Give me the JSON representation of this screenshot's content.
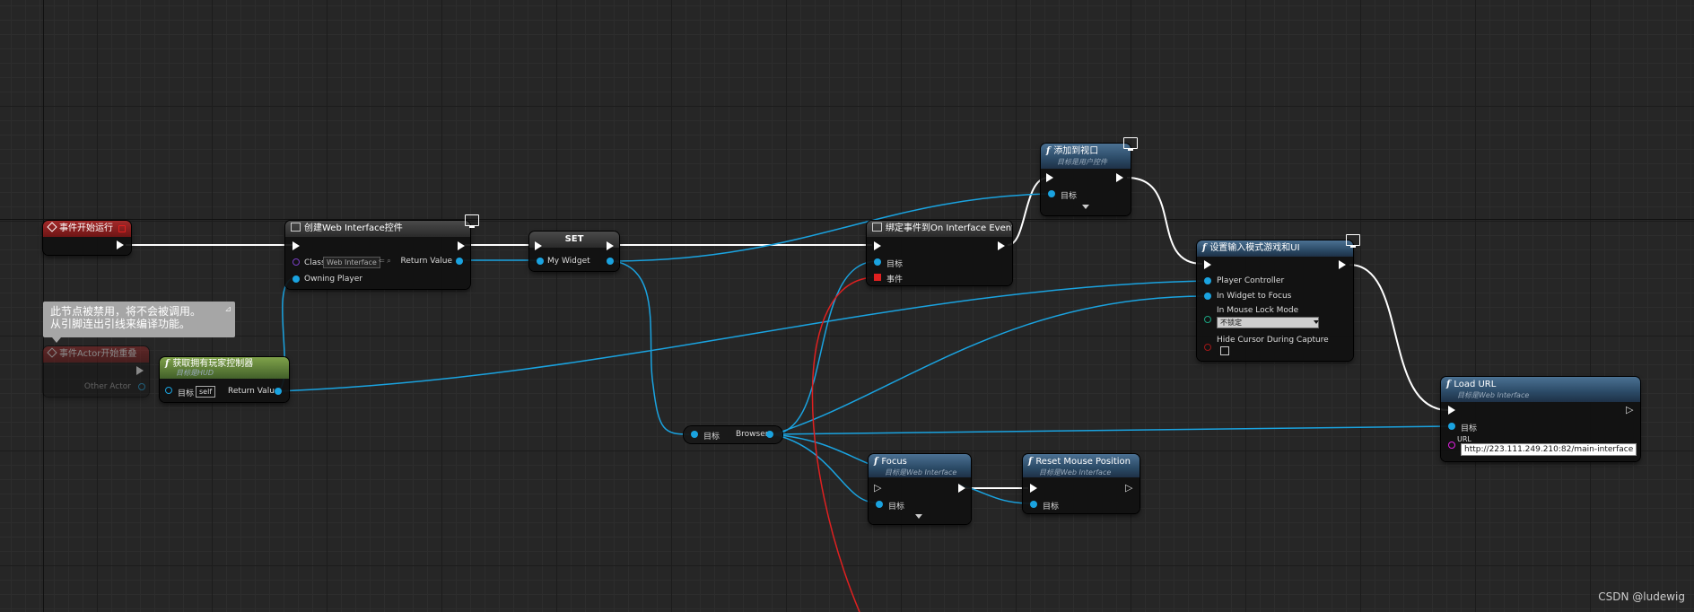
{
  "nodes": {
    "begin_play": {
      "title": "事件开始运行"
    },
    "create_widget": {
      "title": "创建Web Interface控件",
      "class_label": "Class",
      "class_value": "Web Interface",
      "return_label": "Return Value",
      "owning_label": "Owning Player"
    },
    "set": {
      "title": "SET",
      "var_label": "My Widget"
    },
    "bind_event": {
      "title": "绑定事件到On Interface Event",
      "target_label": "目标",
      "event_label": "事件"
    },
    "add_viewport": {
      "title": "添加到视口",
      "subtitle": "目标是用户控件",
      "target_label": "目标"
    },
    "set_input_mode": {
      "title": "设置输入模式游戏和UI",
      "player_controller_label": "Player Controller",
      "widget_focus_label": "In Widget to Focus",
      "mouse_lock_label": "In Mouse Lock Mode",
      "mouse_lock_value": "不锁定",
      "hide_cursor_label": "Hide Cursor During Capture"
    },
    "load_url": {
      "title": "Load URL",
      "subtitle": "目标是Web Interface",
      "target_label": "目标",
      "url_label": "URL",
      "url_value": "http://223.111.249.210:82/main-interface"
    },
    "actor_overlap": {
      "title": "事件Actor开始重叠",
      "other_actor_label": "Other Actor"
    },
    "get_player_controller": {
      "title": "获取拥有玩家控制器",
      "subtitle": "目标是HUD",
      "target_label": "目标",
      "self_value": "self",
      "return_label": "Return Value"
    },
    "browser_getter": {
      "target_label": "目标",
      "browser_label": "Browser"
    },
    "focus": {
      "title": "Focus",
      "subtitle": "目标是Web Interface",
      "target_label": "目标"
    },
    "reset_mouse": {
      "title": "Reset Mouse Position",
      "subtitle": "目标是Web Interface",
      "target_label": "目标"
    }
  },
  "comment": {
    "line1": "此节点被禁用，将不会被调用。",
    "line2": "从引脚连出引线来编译功能。"
  },
  "watermark": "CSDN @ludewig",
  "colors": {
    "exec": "#ffffff",
    "object": "#1aa3e0",
    "delegate": "#e02020",
    "class": "#7a3fc4",
    "url": "#e020e0"
  },
  "icons": [
    "event-diamond-icon",
    "function-icon",
    "monitor-icon",
    "widget-icon",
    "dropdown-arrow-icon",
    "checkbox-icon"
  ]
}
